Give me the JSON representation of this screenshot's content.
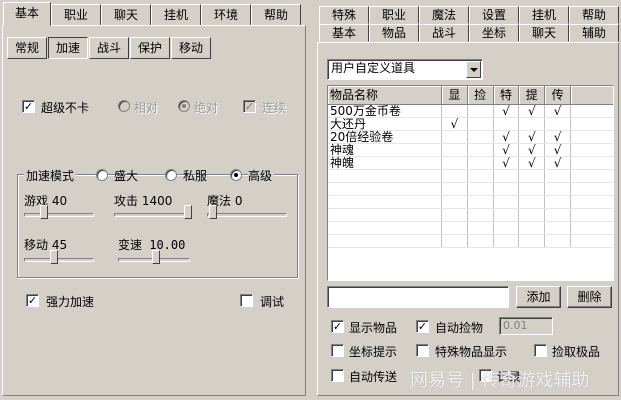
{
  "left": {
    "main_tabs": [
      "基本",
      "职业",
      "聊天",
      "挂机",
      "环境",
      "帮助"
    ],
    "active_main_tab": 0,
    "sub_tabs": [
      "常规",
      "加速",
      "战斗",
      "保护",
      "移动"
    ],
    "active_sub_tab": 1,
    "super_no_lag": {
      "label": "超级不卡",
      "checked": true
    },
    "relative": {
      "label": "相对"
    },
    "absolute": {
      "label": "绝对"
    },
    "continuous": {
      "label": "连续"
    },
    "accel_mode": {
      "label": "加速模式",
      "options": [
        "盛大",
        "私服",
        "高级"
      ],
      "selected": 2
    },
    "sliders": {
      "game": {
        "label": "游戏 40",
        "value": 40
      },
      "attack": {
        "label": "攻击 1400",
        "value": 1400
      },
      "magic": {
        "label": "魔法 0",
        "value": 0
      },
      "move": {
        "label": "移动 45",
        "value": 45
      },
      "speed": {
        "label": "变速 10.00",
        "value": 10.0
      }
    },
    "strong_accel": {
      "label": "强力加速",
      "checked": true
    },
    "debug": {
      "label": "调试",
      "checked": false
    }
  },
  "right": {
    "tabs_row1": [
      "特殊",
      "职业",
      "魔法",
      "设置",
      "挂机",
      "帮助"
    ],
    "tabs_row2": [
      "基本",
      "物品",
      "战斗",
      "坐标",
      "聊天",
      "辅助"
    ],
    "active_tab": "物品",
    "item_type_select": "用户自定义道具",
    "columns": [
      "物品名称",
      "显",
      "捡",
      "特",
      "提",
      "传"
    ],
    "rows": [
      {
        "name": "500万金币卷",
        "show": "",
        "pick": "",
        "special": "√",
        "tip": "√",
        "send": "√"
      },
      {
        "name": "大还丹",
        "show": "√",
        "pick": "",
        "special": "",
        "tip": "",
        "send": ""
      },
      {
        "name": "20倍经验卷",
        "show": "",
        "pick": "",
        "special": "√",
        "tip": "√",
        "send": "√"
      },
      {
        "name": "神魂",
        "show": "",
        "pick": "",
        "special": "√",
        "tip": "√",
        "send": "√"
      },
      {
        "name": "神魄",
        "show": "",
        "pick": "",
        "special": "√",
        "tip": "√",
        "send": "√"
      }
    ],
    "add_button": "添加",
    "delete_button": "删除",
    "show_items": {
      "label": "显示物品",
      "checked": true
    },
    "auto_pick": {
      "label": "自动捡物",
      "checked": true
    },
    "auto_pick_value": "0.01",
    "coord_tip": {
      "label": "坐标提示",
      "checked": false
    },
    "special_display": {
      "label": "特殊物品显示",
      "checked": false
    },
    "pick_best": {
      "label": "捡取极品",
      "checked": false
    },
    "auto_send": {
      "label": "自动传送",
      "checked": false
    },
    "record": {
      "label": "记录"
    }
  },
  "watermark": "网易号 | 传奇游戏辅助"
}
